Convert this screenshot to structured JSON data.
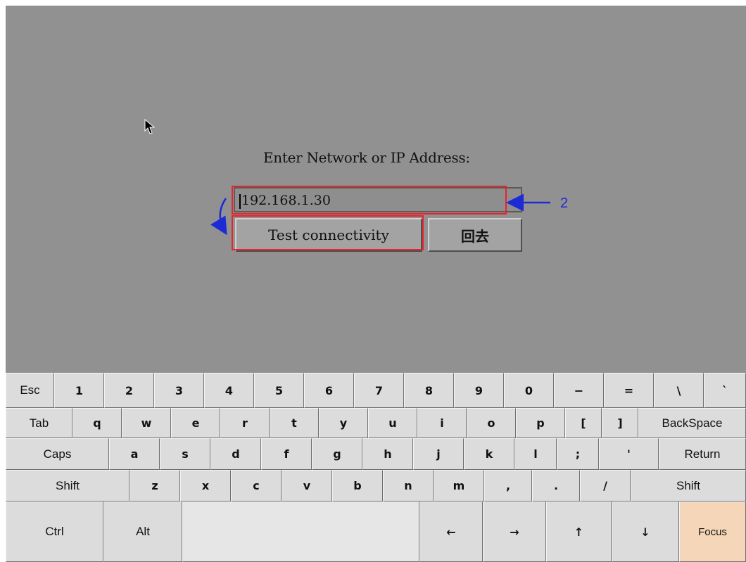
{
  "dialog": {
    "prompt": "Enter Network or IP Address:",
    "ip_value": "192.168.1.30",
    "test_button": "Test connectivity",
    "back_button": "回去"
  },
  "annotation": {
    "label": "2",
    "color_rect": "#e8242a",
    "color_arrow": "#1d2bd4"
  },
  "keyboard": {
    "rows": [
      [
        "Esc",
        "1",
        "2",
        "3",
        "4",
        "5",
        "6",
        "7",
        "8",
        "9",
        "0",
        "−",
        "=",
        "\\",
        "`"
      ],
      [
        "Tab",
        "q",
        "w",
        "e",
        "r",
        "t",
        "y",
        "u",
        "i",
        "o",
        "p",
        "[",
        "]",
        "BackSpace"
      ],
      [
        "Caps",
        "a",
        "s",
        "d",
        "f",
        "g",
        "h",
        "j",
        "k",
        "l",
        ";",
        "'",
        "Return"
      ],
      [
        "Shift",
        "z",
        "x",
        "c",
        "v",
        "b",
        "n",
        "m",
        ",",
        ".",
        "/",
        "Shift"
      ],
      [
        "Ctrl",
        "Alt",
        "",
        "←",
        "→",
        "↑",
        "↓",
        "Focus"
      ]
    ]
  }
}
